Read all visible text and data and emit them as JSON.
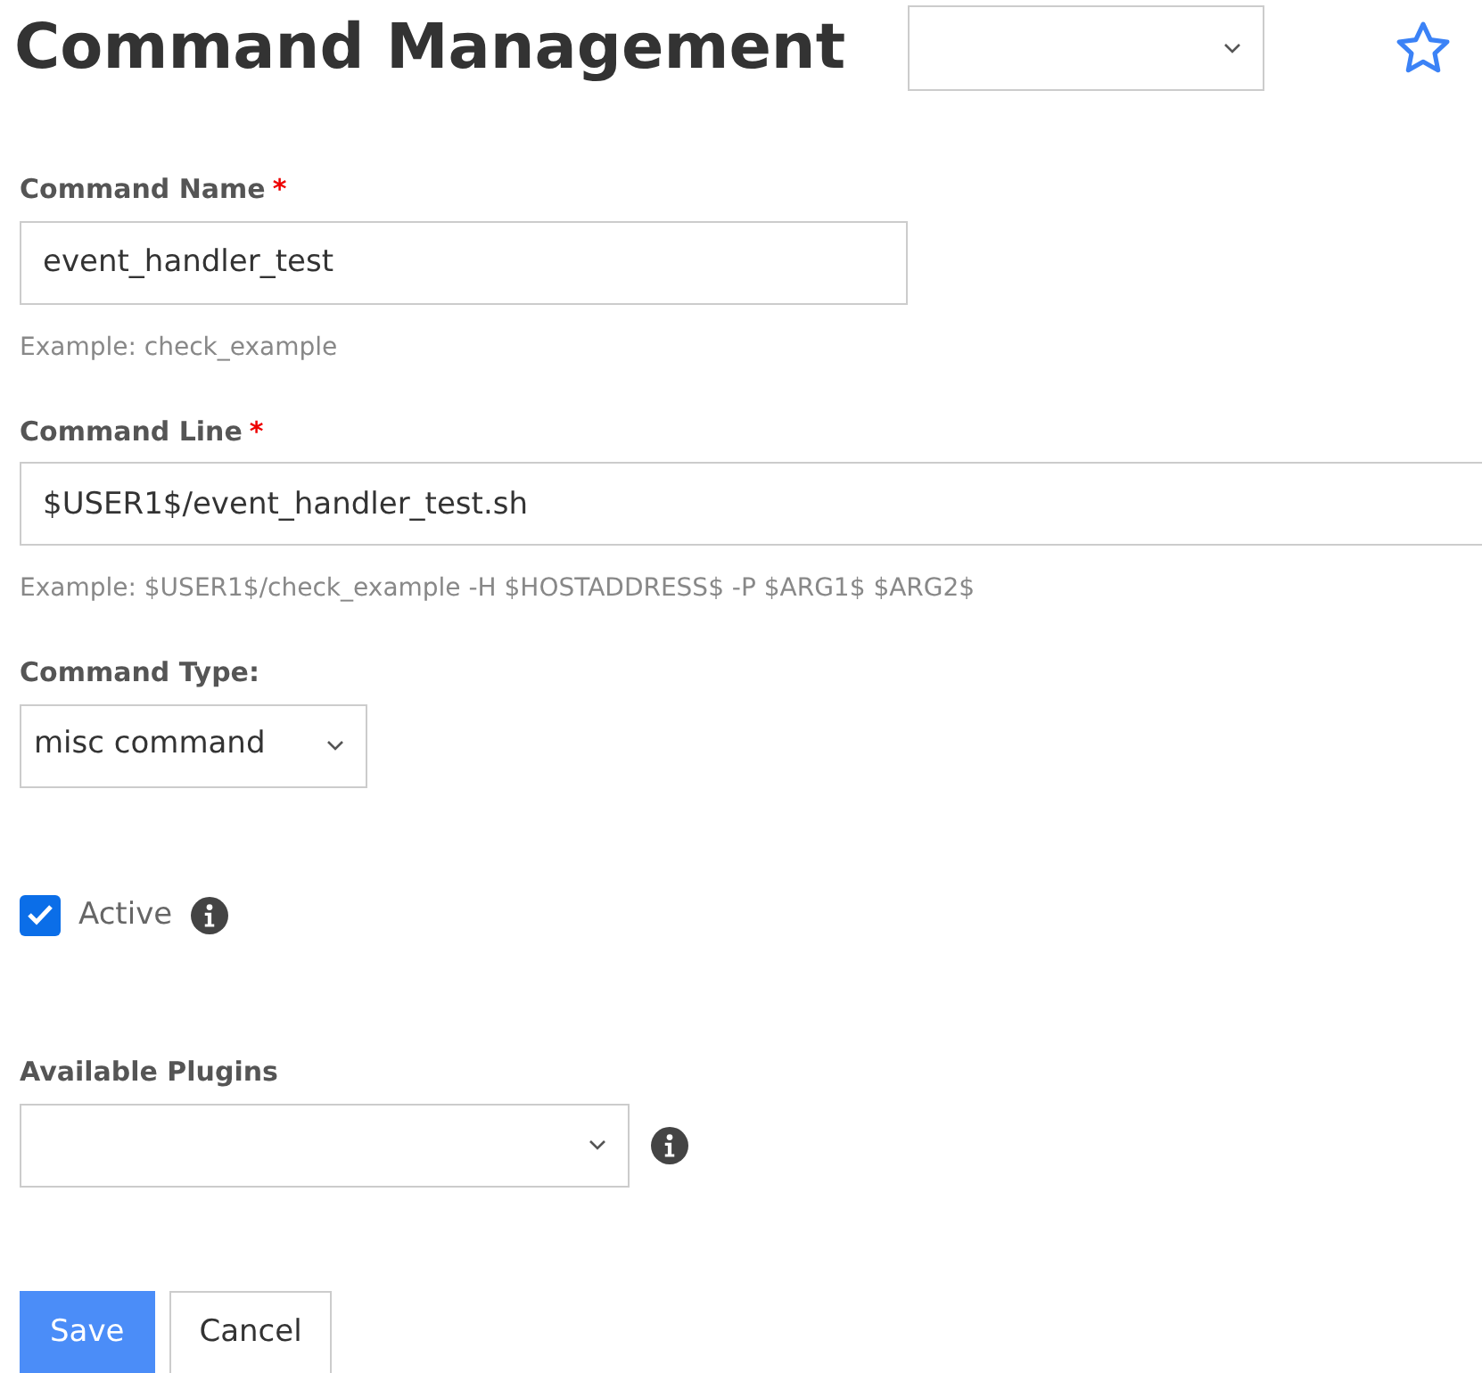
{
  "title": "Command Management",
  "favorite": {
    "starred": false
  },
  "fields": [
    {
      "kind": "text",
      "label": "Command Name",
      "required": true,
      "value": "event_handler_test",
      "help": "Example: check_example"
    },
    {
      "kind": "text",
      "label": "Command Line",
      "required": true,
      "value": "$USER1$/event_handler_test.sh",
      "help": "Example: $USER1$/check_example -H $HOSTADDRESS$ -P $ARG1$ $ARG2$"
    },
    {
      "kind": "select",
      "label": "Command Type:",
      "required": false,
      "value": "misc command",
      "info": false
    },
    {
      "kind": "checkbox",
      "label": "Active",
      "checked": true,
      "info": true
    },
    {
      "kind": "select",
      "label": "Available Plugins",
      "required": false,
      "info": true
    }
  ],
  "required_mark": "*",
  "buttons": [
    {
      "label": "Save",
      "primary": true
    },
    {
      "label": "Cancel",
      "primary": false
    }
  ]
}
